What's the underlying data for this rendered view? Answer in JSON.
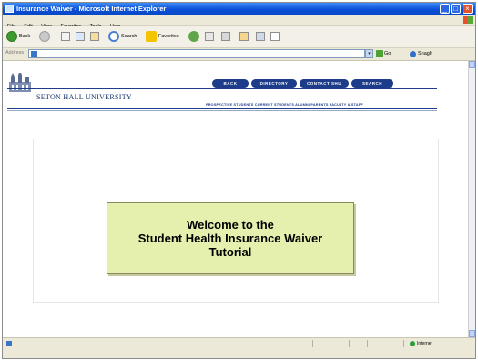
{
  "window": {
    "title": "Insurance Waiver - Microsoft Internet Explorer",
    "buttons": [
      "_",
      "□",
      "×"
    ]
  },
  "menubar": [
    "File",
    "Edit",
    "View",
    "Favorites",
    "Tools",
    "Help"
  ],
  "toolbar": {
    "back_label": "Back",
    "search_label": "Search",
    "favorites_label": "Favorites"
  },
  "address": {
    "label": "Address",
    "value": "",
    "go_label": "Go",
    "snagit_label": "SnagIt"
  },
  "site": {
    "university_name": "SETON HALL UNIVERSITY",
    "nav_buttons": [
      "BACK",
      "DIRECTORY",
      "CONTACT SHU",
      "SEARCH"
    ],
    "sub_nav": "PROSPECTIVE STUDENTS   CURRENT STUDENTS   ALUMNI   PARENTS   FACULTY & STAFF"
  },
  "welcome": {
    "line1": "Welcome to the",
    "line2": "Student Health Insurance Waiver",
    "line3": "Tutorial"
  },
  "statusbar": {
    "zone_label": "Internet"
  },
  "colors": {
    "title_blue": "#0a4fd6",
    "shu_navy": "#1d3c8a",
    "welcome_bg": "#e6f0ae"
  }
}
